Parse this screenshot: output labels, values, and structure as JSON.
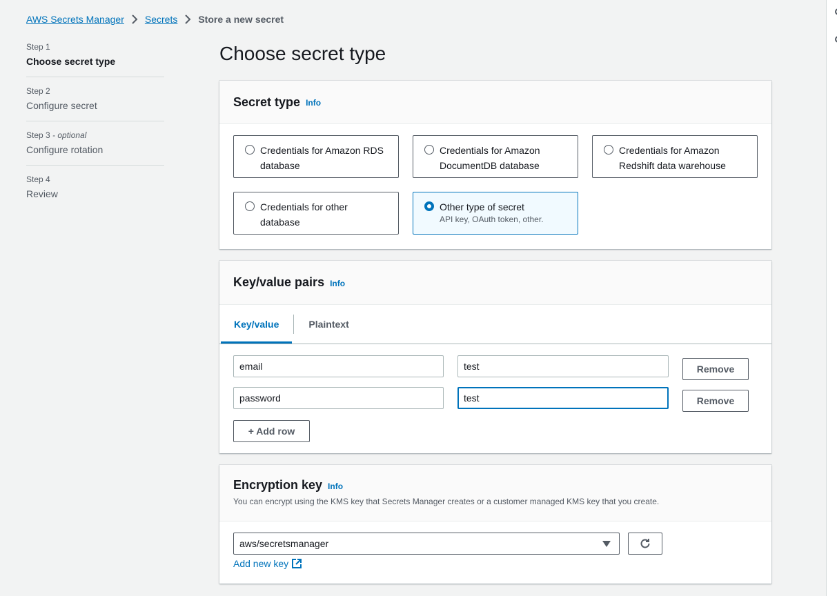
{
  "breadcrumb": {
    "items": [
      "AWS Secrets Manager",
      "Secrets"
    ],
    "current": "Store a new secret"
  },
  "steps": [
    {
      "num": "Step 1",
      "optional": "",
      "title": "Choose secret type"
    },
    {
      "num": "Step 2",
      "optional": "",
      "title": "Configure secret"
    },
    {
      "num": "Step 3",
      "optional": "- optional",
      "title": "Configure rotation"
    },
    {
      "num": "Step 4",
      "optional": "",
      "title": "Review"
    }
  ],
  "page_title": "Choose secret type",
  "secret_type": {
    "title": "Secret type",
    "info": "Info",
    "options": [
      {
        "label": "Credentials for Amazon RDS database",
        "sub": "",
        "selected": false
      },
      {
        "label": "Credentials for Amazon DocumentDB database",
        "sub": "",
        "selected": false
      },
      {
        "label": "Credentials for Amazon Redshift data warehouse",
        "sub": "",
        "selected": false
      },
      {
        "label": "Credentials for other database",
        "sub": "",
        "selected": false
      },
      {
        "label": "Other type of secret",
        "sub": "API key, OAuth token, other.",
        "selected": true
      }
    ]
  },
  "kv": {
    "title": "Key/value pairs",
    "info": "Info",
    "tabs": [
      "Key/value",
      "Plaintext"
    ],
    "active_tab": "Key/value",
    "rows": [
      {
        "key": "email",
        "value": "test"
      },
      {
        "key": "password",
        "value": "test"
      }
    ],
    "remove_label": "Remove",
    "add_row_label": "+ Add row"
  },
  "encryption": {
    "title": "Encryption key",
    "info": "Info",
    "description": "You can encrypt using the KMS key that Secrets Manager creates or a customer managed KMS key that you create.",
    "selected_key": "aws/secretsmanager",
    "add_new_key": "Add new key"
  },
  "colors": {
    "accent": "#0073bb",
    "text": "#16191f",
    "muted": "#545b64",
    "background": "#f2f3f3"
  },
  "icons": [
    "chevron-right-icon",
    "caret-down-icon",
    "refresh-icon",
    "external-link-icon",
    "radio-icon"
  ]
}
